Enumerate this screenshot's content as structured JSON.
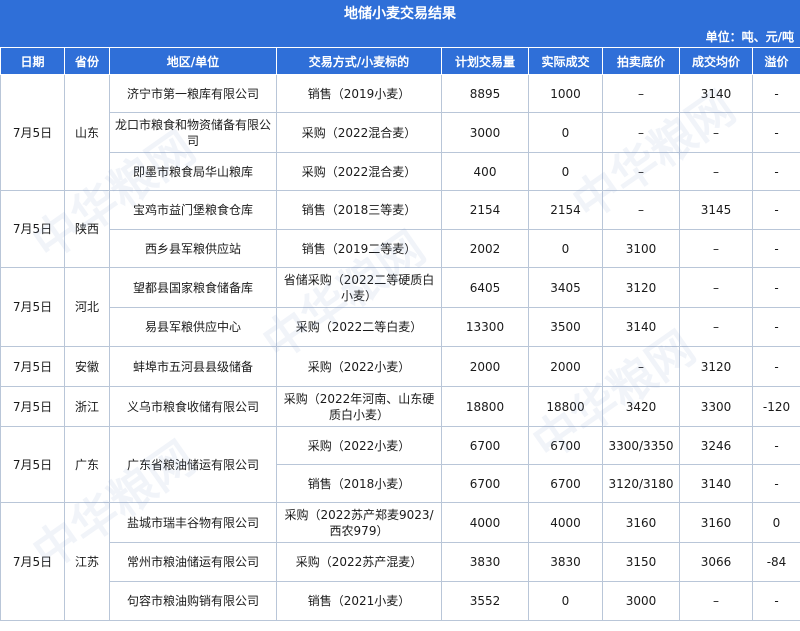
{
  "title": "地储小麦交易结果",
  "unit": "单位：吨、元/吨",
  "columns": [
    "日期",
    "省份",
    "地区/单位",
    "交易方式/小麦标的",
    "计划交易量",
    "实际成交",
    "拍卖底价",
    "成交均价",
    "溢价"
  ],
  "groups": [
    {
      "date": "7月5日",
      "province": "山东",
      "rows": [
        {
          "unit": "济宁市第一粮库有限公司",
          "method": "销售（2019小麦）",
          "plan": "8895",
          "actual": "1000",
          "floor": "–",
          "avg": "3140",
          "premium": "-"
        },
        {
          "unit": "龙口市粮食和物资储备有限公司",
          "method": "采购（2022混合麦）",
          "plan": "3000",
          "actual": "0",
          "floor": "–",
          "avg": "–",
          "premium": "-"
        },
        {
          "unit": "即墨市粮食局华山粮库",
          "method": "采购（2022混合麦）",
          "plan": "400",
          "actual": "0",
          "floor": "–",
          "avg": "–",
          "premium": "-"
        }
      ]
    },
    {
      "date": "7月5日",
      "province": "陕西",
      "rows": [
        {
          "unit": "宝鸡市益门堡粮食仓库",
          "method": "销售（2018三等麦）",
          "plan": "2154",
          "actual": "2154",
          "floor": "–",
          "avg": "3145",
          "premium": "-"
        },
        {
          "unit": "西乡县军粮供应站",
          "method": "销售（2019二等麦）",
          "plan": "2002",
          "actual": "0",
          "floor": "3100",
          "avg": "–",
          "premium": "-"
        }
      ]
    },
    {
      "date": "7月5日",
      "province": "河北",
      "rows": [
        {
          "unit": "望都县国家粮食储备库",
          "method": "省储采购（2022二等硬质白小麦）",
          "plan": "6405",
          "actual": "3405",
          "floor": "3120",
          "avg": "–",
          "premium": "-"
        },
        {
          "unit": "易县军粮供应中心",
          "method": "采购（2022二等白麦）",
          "plan": "13300",
          "actual": "3500",
          "floor": "3140",
          "avg": "–",
          "premium": "-"
        }
      ]
    },
    {
      "date": "7月5日",
      "province": "安徽",
      "rows": [
        {
          "unit": "蚌埠市五河县县级储备",
          "method": "采购（2022小麦）",
          "plan": "2000",
          "actual": "2000",
          "floor": "–",
          "avg": "3120",
          "premium": "-"
        }
      ]
    },
    {
      "date": "7月5日",
      "province": "浙江",
      "rows": [
        {
          "unit": "义乌市粮食收储有限公司",
          "method": "采购（2022年河南、山东硬质白小麦）",
          "plan": "18800",
          "actual": "18800",
          "floor": "3420",
          "avg": "3300",
          "premium": "-120"
        }
      ]
    },
    {
      "date": "7月5日",
      "province": "广东",
      "unit_merged": "广东省粮油储运有限公司",
      "rows": [
        {
          "unit": "广东省粮油储运有限公司",
          "method": "采购（2022小麦）",
          "plan": "6700",
          "actual": "6700",
          "floor": "3300/3350",
          "avg": "3246",
          "premium": "-"
        },
        {
          "unit": "",
          "method": "销售（2018小麦）",
          "plan": "6700",
          "actual": "6700",
          "floor": "3120/3180",
          "avg": "3140",
          "premium": "-"
        }
      ]
    },
    {
      "date": "7月5日",
      "province": "江苏",
      "rows": [
        {
          "unit": "盐城市瑞丰谷物有限公司",
          "method": "采购（2022苏产郑麦9023/西农979）",
          "plan": "4000",
          "actual": "4000",
          "floor": "3160",
          "avg": "3160",
          "premium": "0"
        },
        {
          "unit": "常州市粮油储运有限公司",
          "method": "采购（2022苏产混麦）",
          "plan": "3830",
          "actual": "3830",
          "floor": "3150",
          "avg": "3066",
          "premium": "-84"
        },
        {
          "unit": "句容市粮油购销有限公司",
          "method": "销售（2021小麦）",
          "plan": "3552",
          "actual": "0",
          "floor": "3000",
          "avg": "–",
          "premium": "-"
        }
      ]
    }
  ],
  "watermark": "中华粮网"
}
